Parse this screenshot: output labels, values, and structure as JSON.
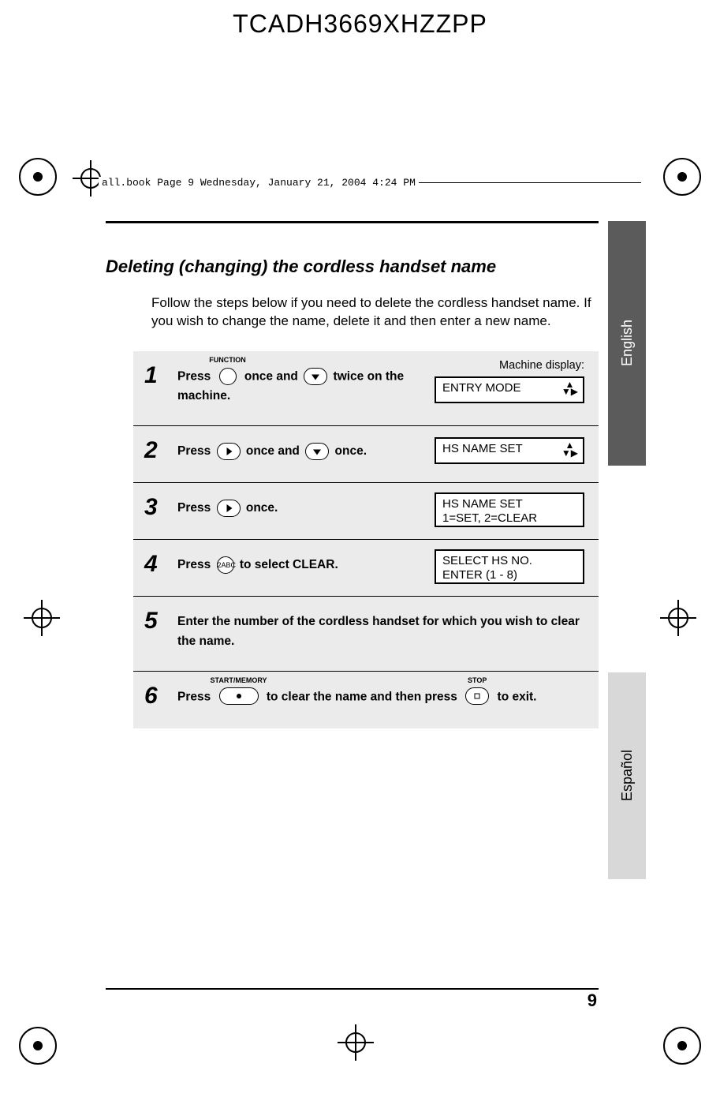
{
  "doc_id": "TCADH3669XHZZPP",
  "slug": "all.book  Page 9  Wednesday, January 21, 2004  4:24 PM",
  "heading": "Deleting (changing) the cordless handset name",
  "intro": "Follow the steps below if you need to delete the cordless handset name. If you wish to change the name, delete it and then enter a new name.",
  "machine_display_label": "Machine display:",
  "steps": [
    {
      "num": "1",
      "parts": [
        "Press ",
        "FUNCTION_BTN",
        " once and ",
        "DOWN_BTN",
        " twice on the machine."
      ],
      "display": {
        "lines": "one",
        "text1": "ENTRY MODE",
        "text2": "",
        "arrows": true
      }
    },
    {
      "num": "2",
      "parts": [
        "Press ",
        "RIGHT_BTN",
        " once and ",
        "DOWN_BTN",
        " once."
      ],
      "display": {
        "lines": "one",
        "text1": "HS NAME SET",
        "text2": "",
        "arrows": true
      }
    },
    {
      "num": "3",
      "parts": [
        "Press ",
        "RIGHT_BTN",
        " once."
      ],
      "display": {
        "lines": "two",
        "text1": "HS NAME SET",
        "text2": "1=SET, 2=CLEAR",
        "arrows": false
      }
    },
    {
      "num": "4",
      "parts": [
        "Press ",
        "KEY2_BTN",
        " to select CLEAR."
      ],
      "display": {
        "lines": "two",
        "text1": "SELECT HS NO.",
        "text2": "ENTER (1 - 8)",
        "arrows": false
      }
    },
    {
      "num": "5",
      "parts": [
        "Enter the number of the cordless handset for which you wish to clear the name."
      ],
      "display": null
    },
    {
      "num": "6",
      "parts": [
        "Press ",
        "START_BTN",
        " to clear the name and then press ",
        "STOP_BTN",
        " to exit."
      ],
      "display": null
    }
  ],
  "buttons": {
    "FUNCTION_BTN": {
      "label": "FUNCTION"
    },
    "START_BTN": {
      "label": "START/MEMORY"
    },
    "STOP_BTN": {
      "label": "STOP"
    },
    "KEY2_BTN": {
      "label": "2ABC"
    }
  },
  "tabs": {
    "english": "English",
    "espanol": "Español"
  },
  "page_number": "9"
}
